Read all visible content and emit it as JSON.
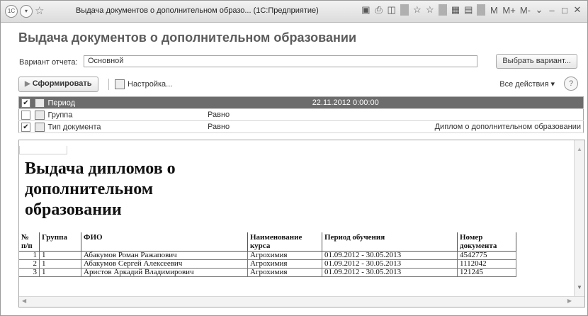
{
  "window": {
    "title": "Выдача документов о дополнительном образо... (1С:Предприятие)",
    "app_icon": "1С",
    "toolbar_labels": [
      "M",
      "M+",
      "M-"
    ]
  },
  "page_title": "Выдача документов о дополнительном образовании",
  "variant": {
    "label": "Вариант отчета:",
    "value": "Основной",
    "choose_button": "Выбрать вариант..."
  },
  "actions": {
    "form": "Сформировать",
    "settings": "Настройка...",
    "all_actions": "Все действия ▾",
    "help": "?"
  },
  "settings_rows": [
    {
      "checked": true,
      "name": "Период",
      "condition": "",
      "value": "22.11.2012 0:00:00"
    },
    {
      "checked": false,
      "name": "Группа",
      "condition": "Равно",
      "value": ""
    },
    {
      "checked": true,
      "name": "Тип документа",
      "condition": "Равно",
      "value": "Диплом о дополнительном образовании"
    }
  ],
  "report": {
    "title": "Выдача дипломов о дополнительном образовании",
    "headers": [
      "№ п/п",
      "Группа",
      "ФИО",
      "Наименование курса",
      "Период обучения",
      "Номер документа"
    ],
    "rows": [
      {
        "n": "1",
        "group": "1",
        "fio": "Абакумов Роман Ражапович",
        "course": "Агрохимия",
        "period": "01.09.2012 - 30.05.2013",
        "doc": "4542775"
      },
      {
        "n": "2",
        "group": "1",
        "fio": "Абакумов Сергей Алексеевич",
        "course": "Агрохимия",
        "period": "01.09.2012 - 30.05.2013",
        "doc": "1112042"
      },
      {
        "n": "3",
        "group": "1",
        "fio": "Аристов Аркадий Владимирович",
        "course": "Агрохимия",
        "period": "01.09.2012 - 30.05.2013",
        "doc": "121245"
      }
    ]
  }
}
